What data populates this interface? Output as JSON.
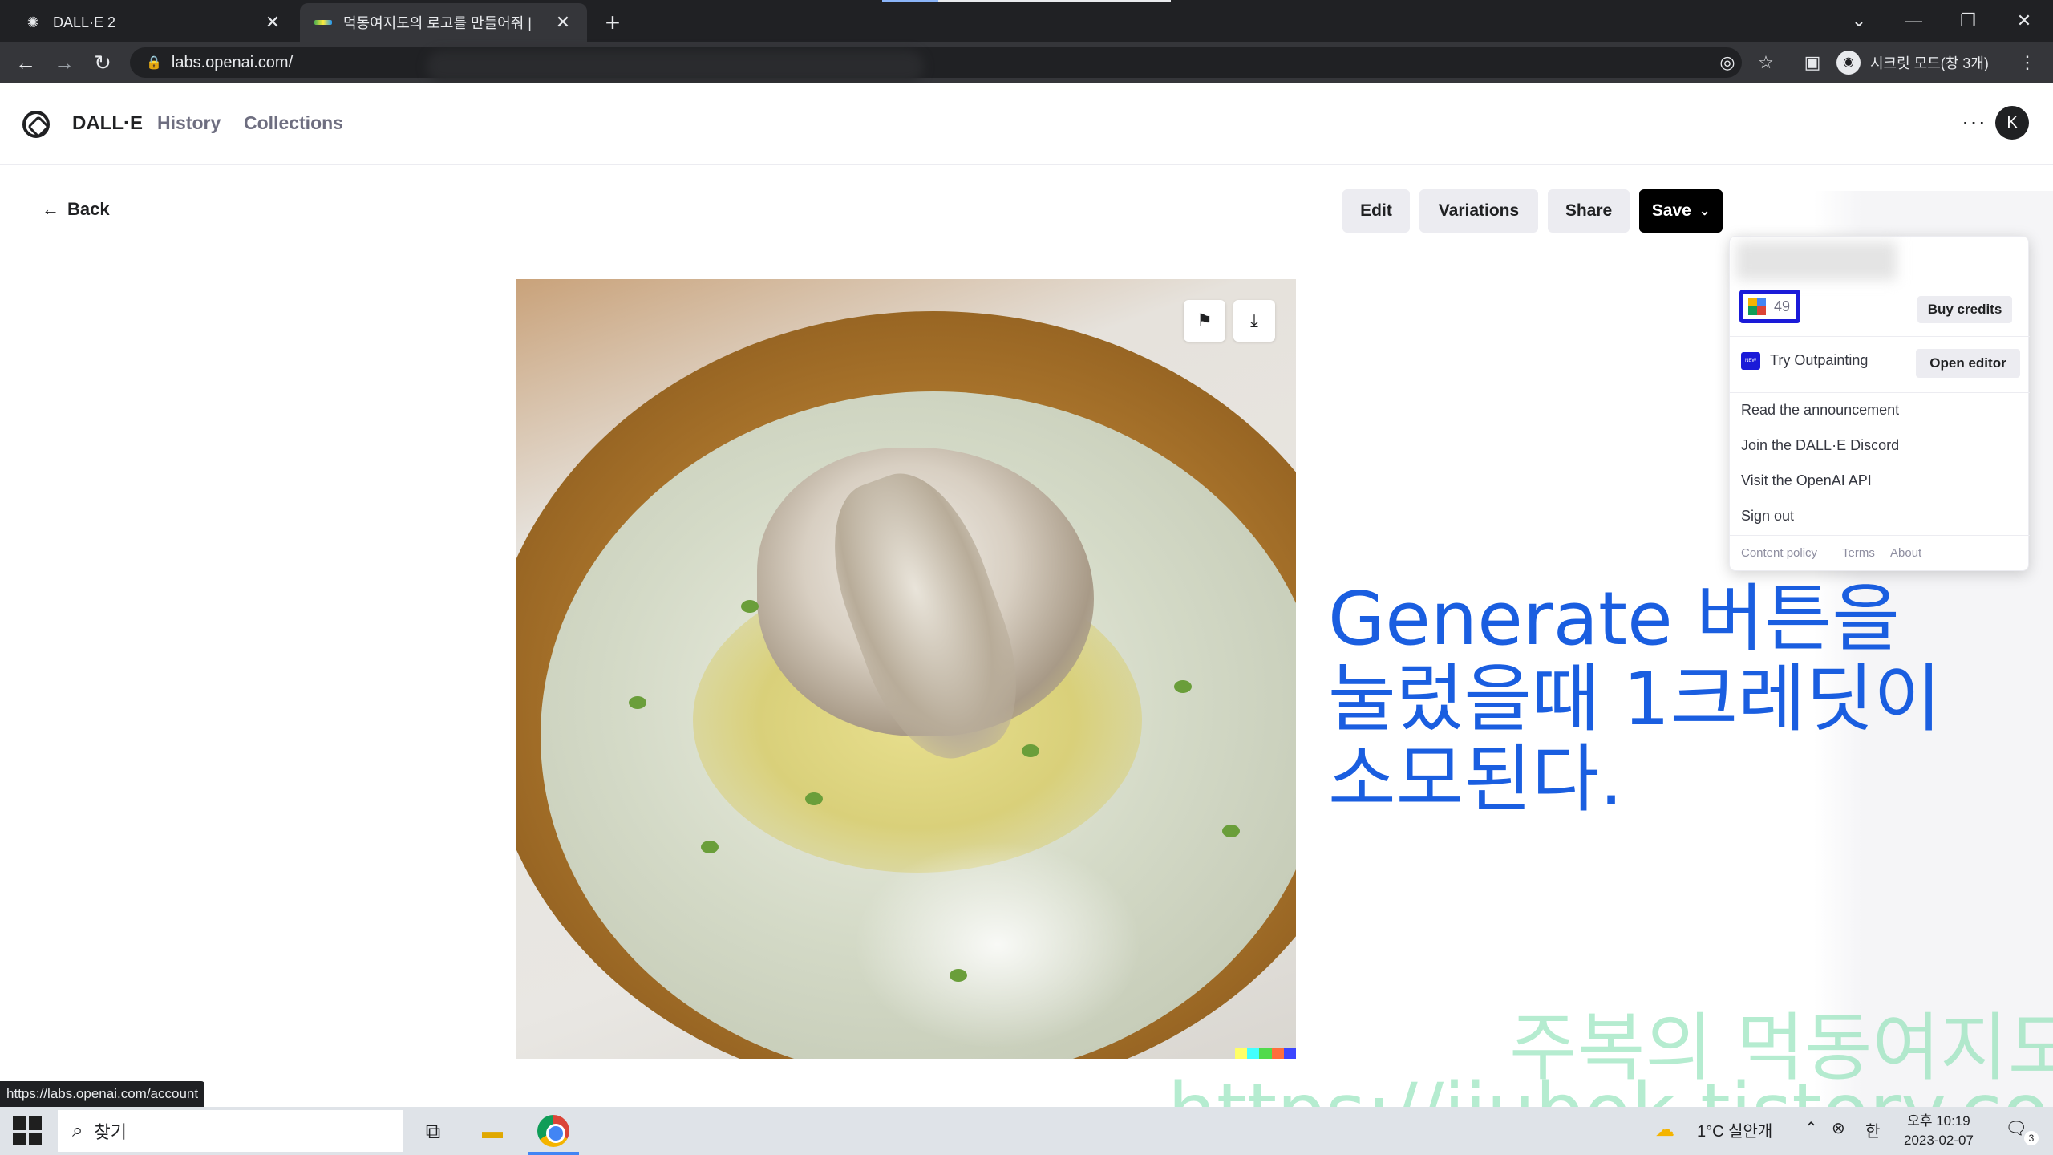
{
  "browser": {
    "tabs": [
      {
        "title": "DALL·E 2",
        "close": "✕"
      },
      {
        "title": "먹동여지도의 로고를 만들어줘 |",
        "close": "✕"
      }
    ],
    "new_tab": "+",
    "url": "labs.openai.com/",
    "incognito_label": "시크릿 모드(창 3개)",
    "window_controls": [
      "⌄",
      "—",
      "❐",
      "✕"
    ]
  },
  "app": {
    "brand": "DALL·E",
    "nav": [
      "History",
      "Collections"
    ],
    "more": "···",
    "avatar_initial": "K"
  },
  "toolbar": {
    "back": "Back",
    "edit": "Edit",
    "variations": "Variations",
    "share": "Share",
    "save": "Save"
  },
  "dropdown": {
    "credits": "49",
    "buy_credits": "Buy credits",
    "new_badge": "NEW",
    "try_outpainting": "Try Outpainting",
    "open_editor": "Open editor",
    "items": [
      "Read the announcement",
      "Join the DALL·E Discord",
      "Visit the OpenAI API",
      "Sign out"
    ],
    "footer": [
      "Content policy",
      "Terms",
      "About"
    ]
  },
  "annotation": {
    "line1": "Generate 버튼을",
    "line2": "눌렀을때 1크레딧이",
    "line3": "소모된다.",
    "color": "#1a5ee0"
  },
  "status_url": "https://labs.openai.com/account",
  "watermark": {
    "line1": "주복의 먹동여지도",
    "line2": "https://jjubok.tistory.com"
  },
  "taskbar": {
    "search_text": "찾기",
    "weather": "1°C  실안개",
    "ime": "한",
    "time": "오후 10:19",
    "date": "2023-02-07",
    "notifications": "3"
  }
}
